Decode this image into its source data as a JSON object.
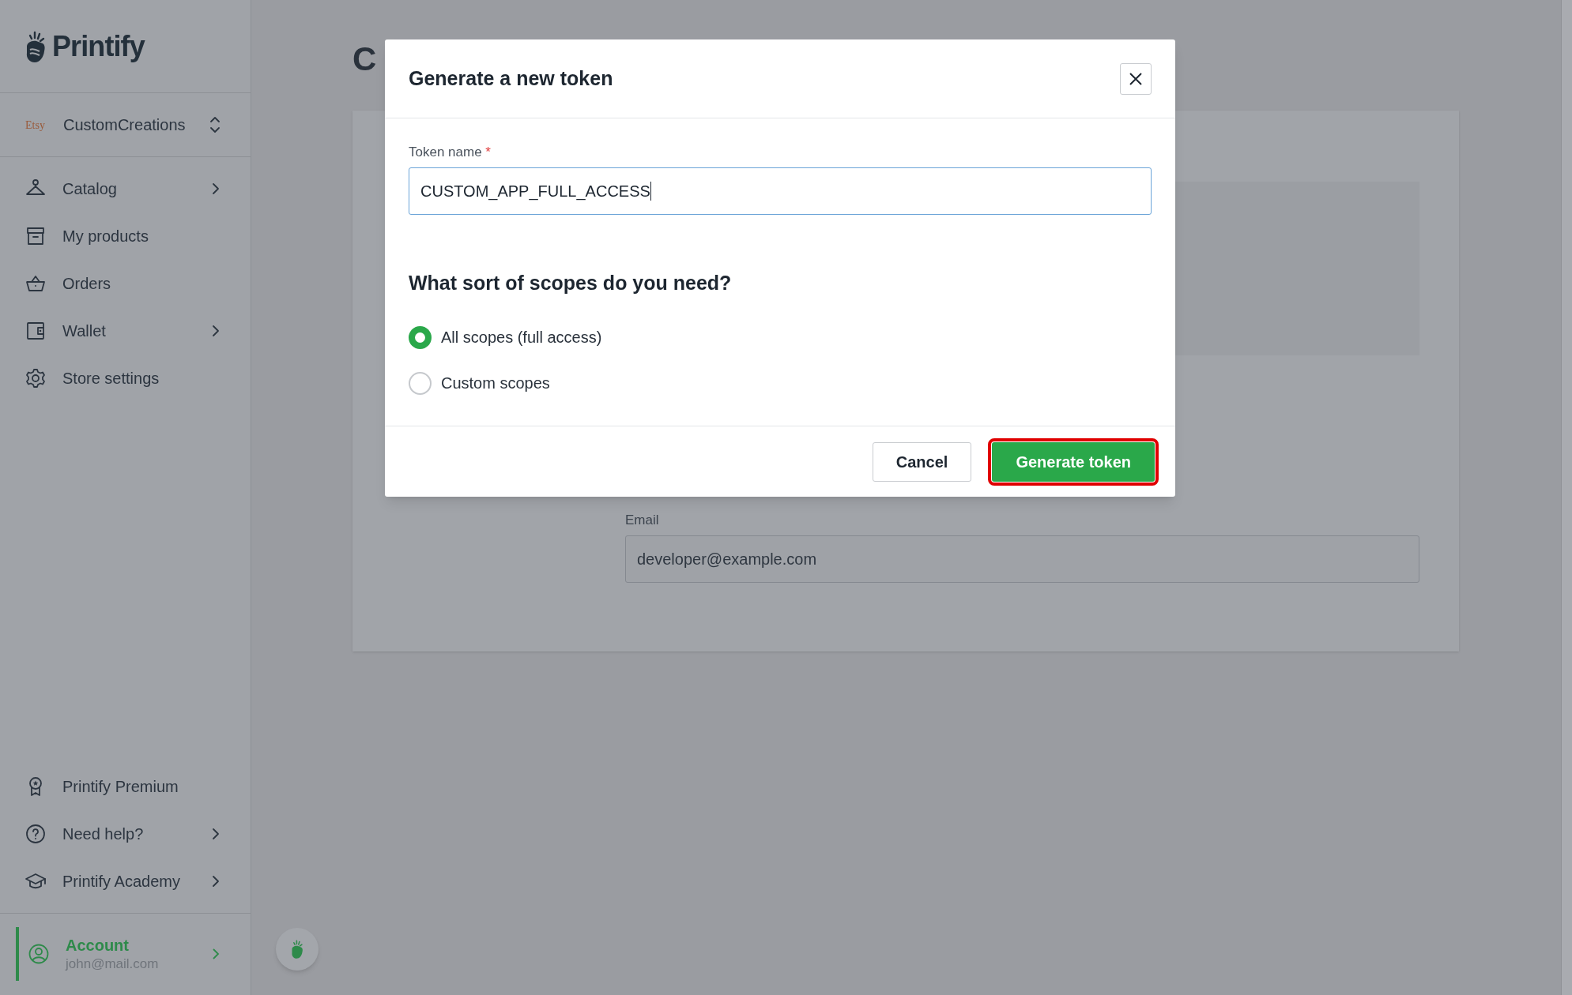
{
  "sidebar": {
    "logo": "Printify",
    "store": {
      "platform": "Etsy",
      "name": "CustomCreations"
    },
    "nav_items": [
      {
        "label": "Catalog",
        "has_submenu": true
      },
      {
        "label": "My products",
        "has_submenu": false
      },
      {
        "label": "Orders",
        "has_submenu": false
      },
      {
        "label": "Wallet",
        "has_submenu": true
      },
      {
        "label": "Store settings",
        "has_submenu": false
      }
    ],
    "bottom_items": [
      {
        "label": "Printify Premium",
        "has_submenu": false
      },
      {
        "label": "Need help?",
        "has_submenu": true
      },
      {
        "label": "Printify Academy",
        "has_submenu": true
      }
    ],
    "account": {
      "label": "Account",
      "email": "john@mail.com",
      "selected": true
    }
  },
  "page": {
    "heading": "C",
    "email_field": {
      "label": "Email",
      "value": "developer@example.com"
    }
  },
  "dialog": {
    "title": "Generate a new token",
    "token_field": {
      "label": "Token name",
      "required_mark": "*",
      "value": "CUSTOM_APP_FULL_ACCESS"
    },
    "scopes_heading": "What sort of scopes do you need?",
    "options": [
      {
        "label": "All scopes (full access)",
        "selected": true
      },
      {
        "label": "Custom scopes",
        "selected": false
      }
    ],
    "buttons": [
      {
        "label": "Cancel",
        "kind": "secondary",
        "highlighted": false
      },
      {
        "label": "Generate token",
        "kind": "primary",
        "highlighted": true
      }
    ]
  }
}
